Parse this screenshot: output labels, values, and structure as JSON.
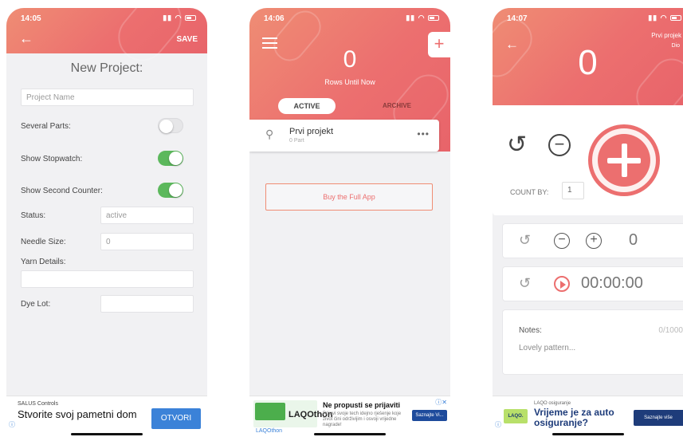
{
  "status_bar": {
    "times": [
      "14:05",
      "14:06",
      "14:07"
    ],
    "system_icons": "signal-wifi-battery"
  },
  "colors": {
    "accent": "#ec6f6f",
    "toggle_on": "#5cb85c",
    "ad_button": "#3b82d8"
  },
  "screen1": {
    "save_label": "SAVE",
    "title": "New Project:",
    "project_name_placeholder": "Project Name",
    "several_parts_label": "Several Parts:",
    "show_stopwatch_label": "Show Stopwatch:",
    "show_second_counter_label": "Show Second Counter:",
    "toggles": {
      "several_parts": false,
      "show_stopwatch": true,
      "show_second_counter": true
    },
    "status_label": "Status:",
    "status_value": "active",
    "needle_size_label": "Needle Size:",
    "needle_size_value": "0",
    "yarn_details_label": "Yarn Details:",
    "yarn_details_value": "",
    "dye_lot_label": "Dye Lot:",
    "dye_lot_value": "",
    "ad": {
      "brand": "SALUS Controls",
      "headline": "Stvorite svoj pametni dom",
      "cta": "OTVORI"
    }
  },
  "screen2": {
    "count": "0",
    "count_label": "Rows Until Now",
    "tab_active": "ACTIVE",
    "tab_archive": "ARCHIVE",
    "project": {
      "name": "Prvi projekt",
      "subtitle": "0 Part"
    },
    "buy_label": "Buy the Full App",
    "ad": {
      "logo": "LAQOthon",
      "headline": "Ne propusti se prijaviti",
      "body": "Prijavi svoje tech idejno rješenje koje život čini održivijim i osvoji vrijedne nagrade!",
      "sponsor": "LAQOthon",
      "cta": "Saznajte Vi..."
    }
  },
  "screen3": {
    "project_name": "Prvi projek",
    "project_part": "Dio",
    "count": "0",
    "count_by_label": "COUNT BY:",
    "count_by_value": "1",
    "second_counter_value": "0",
    "stopwatch_value": "00:00:00",
    "notes_label": "Notes:",
    "notes_count": "0/1000",
    "notes_text": "Lovely pattern...",
    "ad": {
      "logo": "LAQO.",
      "brand": "LAQO osiguranje",
      "headline": "Vrijeme je za auto osiguranje?",
      "cta": "Saznajte više"
    }
  }
}
